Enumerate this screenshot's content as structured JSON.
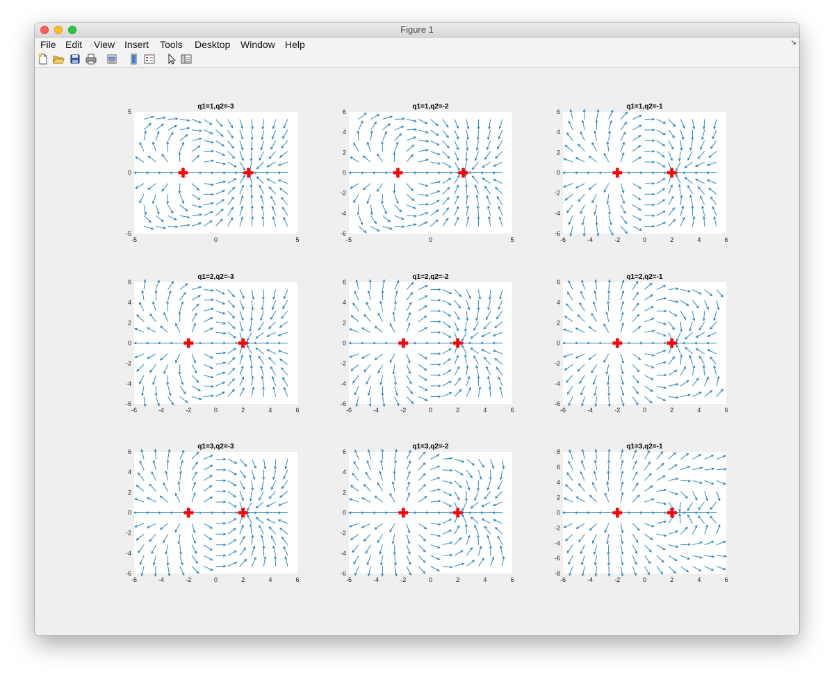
{
  "window": {
    "title": "Figure 1"
  },
  "menu": [
    "File",
    "Edit",
    "View",
    "Insert",
    "Tools",
    "Desktop",
    "Window",
    "Help"
  ],
  "toolbar": [
    "new-figure-icon",
    "open-file-icon",
    "save-icon",
    "print-icon",
    "print-preview-icon",
    "colorbar-icon",
    "legend-icon",
    "pointer-icon",
    "property-inspector-icon"
  ],
  "colors": {
    "arrow": "#2a88c4",
    "charge": "#ff0000"
  },
  "chart_data": [
    {
      "type": "quiver",
      "title": "q1=1,q2=-3",
      "q1": 1,
      "q2": -3,
      "charges_x": [
        -2,
        2
      ],
      "xlim": [
        -5,
        5
      ],
      "ylim": [
        -5,
        5
      ],
      "xticks": [
        -5,
        0,
        5
      ],
      "yticks": [
        -5,
        0,
        5
      ]
    },
    {
      "type": "quiver",
      "title": "q1=1,q2=-2",
      "q1": 1,
      "q2": -2,
      "charges_x": [
        -2,
        2
      ],
      "xlim": [
        -5,
        5
      ],
      "ylim": [
        -6,
        6
      ],
      "xticks": [
        -5,
        0,
        5
      ],
      "yticks": [
        -6,
        -4,
        -2,
        0,
        2,
        4,
        6
      ]
    },
    {
      "type": "quiver",
      "title": "q1=1,q2=-1",
      "q1": 1,
      "q2": -1,
      "charges_x": [
        -2,
        2
      ],
      "xlim": [
        -6,
        6
      ],
      "ylim": [
        -6,
        6
      ],
      "xticks": [
        -6,
        -4,
        -2,
        0,
        2,
        4,
        6
      ],
      "yticks": [
        -6,
        -4,
        -2,
        0,
        2,
        4,
        6
      ]
    },
    {
      "type": "quiver",
      "title": "q1=2,q2=-3",
      "q1": 2,
      "q2": -3,
      "charges_x": [
        -2,
        2
      ],
      "xlim": [
        -6,
        6
      ],
      "ylim": [
        -6,
        6
      ],
      "xticks": [
        -6,
        -4,
        -2,
        0,
        2,
        4,
        6
      ],
      "yticks": [
        -6,
        -4,
        -2,
        0,
        2,
        4,
        6
      ]
    },
    {
      "type": "quiver",
      "title": "q1=2,q2=-2",
      "q1": 2,
      "q2": -2,
      "charges_x": [
        -2,
        2
      ],
      "xlim": [
        -6,
        6
      ],
      "ylim": [
        -6,
        6
      ],
      "xticks": [
        -6,
        -4,
        -2,
        0,
        2,
        4,
        6
      ],
      "yticks": [
        -6,
        -4,
        -2,
        0,
        2,
        4,
        6
      ]
    },
    {
      "type": "quiver",
      "title": "q1=2,q2=-1",
      "q1": 2,
      "q2": -1,
      "charges_x": [
        -2,
        2
      ],
      "xlim": [
        -6,
        6
      ],
      "ylim": [
        -6,
        6
      ],
      "xticks": [
        -6,
        -4,
        -2,
        0,
        2,
        4,
        6
      ],
      "yticks": [
        -6,
        -4,
        -2,
        0,
        2,
        4,
        6
      ]
    },
    {
      "type": "quiver",
      "title": "q1=3,q2=-3",
      "q1": 3,
      "q2": -3,
      "charges_x": [
        -2,
        2
      ],
      "xlim": [
        -6,
        6
      ],
      "ylim": [
        -6,
        6
      ],
      "xticks": [
        -6,
        -4,
        -2,
        0,
        2,
        4,
        6
      ],
      "yticks": [
        -6,
        -4,
        -2,
        0,
        2,
        4,
        6
      ]
    },
    {
      "type": "quiver",
      "title": "q1=3,q2=-2",
      "q1": 3,
      "q2": -2,
      "charges_x": [
        -2,
        2
      ],
      "xlim": [
        -6,
        6
      ],
      "ylim": [
        -6,
        6
      ],
      "xticks": [
        -6,
        -4,
        -2,
        0,
        2,
        4,
        6
      ],
      "yticks": [
        -6,
        -4,
        -2,
        0,
        2,
        4,
        6
      ]
    },
    {
      "type": "quiver",
      "title": "q1=3,q2=-1",
      "q1": 3,
      "q2": -1,
      "charges_x": [
        -2,
        2
      ],
      "xlim": [
        -6,
        6
      ],
      "ylim": [
        -8,
        8
      ],
      "xticks": [
        -6,
        -4,
        -2,
        0,
        2,
        4,
        6
      ],
      "yticks": [
        -8,
        -6,
        -4,
        -2,
        0,
        2,
        4,
        6,
        8
      ]
    }
  ]
}
